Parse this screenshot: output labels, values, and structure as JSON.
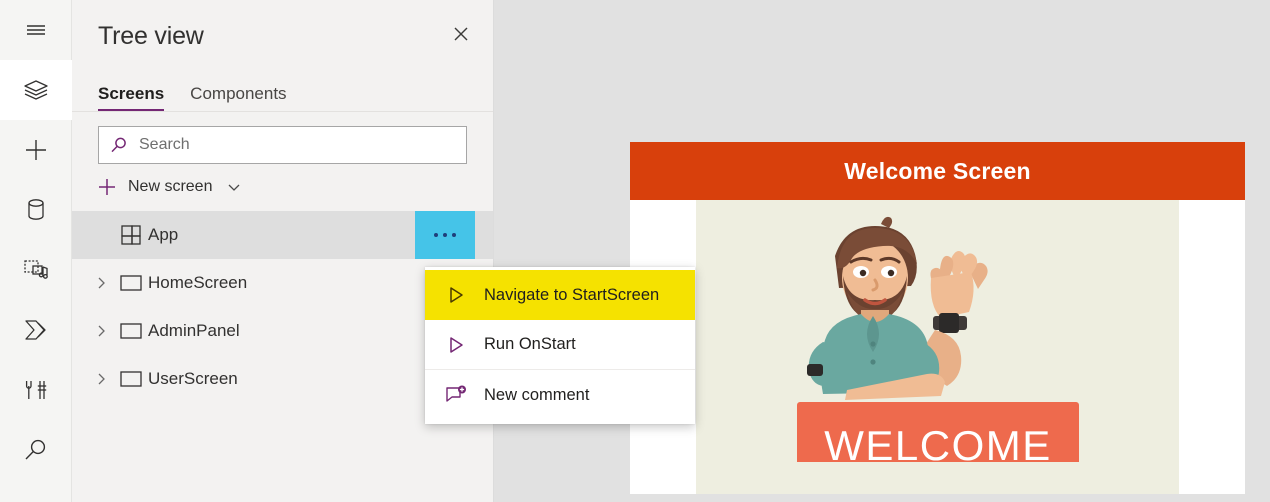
{
  "rail": {
    "items": [
      {
        "name": "hamburger-menu",
        "icon": "hamburger-icon",
        "active": false
      },
      {
        "name": "tree-view",
        "icon": "layers-icon",
        "active": true
      },
      {
        "name": "insert",
        "icon": "plus-icon",
        "active": false
      },
      {
        "name": "data",
        "icon": "database-icon",
        "active": false
      },
      {
        "name": "media",
        "icon": "media-icon",
        "active": false
      },
      {
        "name": "power-automate",
        "icon": "power-automate-icon",
        "active": false
      },
      {
        "name": "settings-tools",
        "icon": "tools-icon",
        "active": false
      },
      {
        "name": "search",
        "icon": "search-icon",
        "active": false
      }
    ]
  },
  "tree_panel": {
    "title": "Tree view",
    "close_label": "Close",
    "tabs": [
      {
        "label": "Screens",
        "active": true
      },
      {
        "label": "Components",
        "active": false
      }
    ],
    "search": {
      "placeholder": "Search",
      "value": ""
    },
    "new_screen": {
      "label": "New screen"
    },
    "items": [
      {
        "label": "App",
        "icon": "app-grid-icon",
        "selected": true,
        "has_chevron": false,
        "has_more": true
      },
      {
        "label": "HomeScreen",
        "icon": "screen-icon",
        "selected": false,
        "has_chevron": true,
        "has_more": false
      },
      {
        "label": "AdminPanel",
        "icon": "screen-icon",
        "selected": false,
        "has_chevron": true,
        "has_more": false
      },
      {
        "label": "UserScreen",
        "icon": "screen-icon",
        "selected": false,
        "has_chevron": true,
        "has_more": false
      }
    ],
    "more_button_label": "More commands"
  },
  "context_menu": {
    "items": [
      {
        "label": "Navigate to StartScreen",
        "icon": "play-triangle-icon",
        "highlighted": true
      },
      {
        "label": "Run OnStart",
        "icon": "play-triangle-icon",
        "highlighted": false
      },
      {
        "label": "New comment",
        "icon": "comment-add-icon",
        "highlighted": false
      }
    ]
  },
  "canvas": {
    "app_screen": {
      "header_title": "Welcome Screen",
      "illustration": {
        "sign_text": "WELCOME",
        "alt": "Illustration of a bearded man waving behind a welcome sign"
      }
    }
  },
  "colors": {
    "accent_purple": "#742774",
    "header_orange": "#d8400c",
    "highlight_yellow": "#f5e200",
    "more_button_cyan": "#45c4e8",
    "sign_salmon": "#ee6a4d",
    "illustration_bg": "#eeeee0",
    "canvas_bg": "#e1e1e1"
  }
}
